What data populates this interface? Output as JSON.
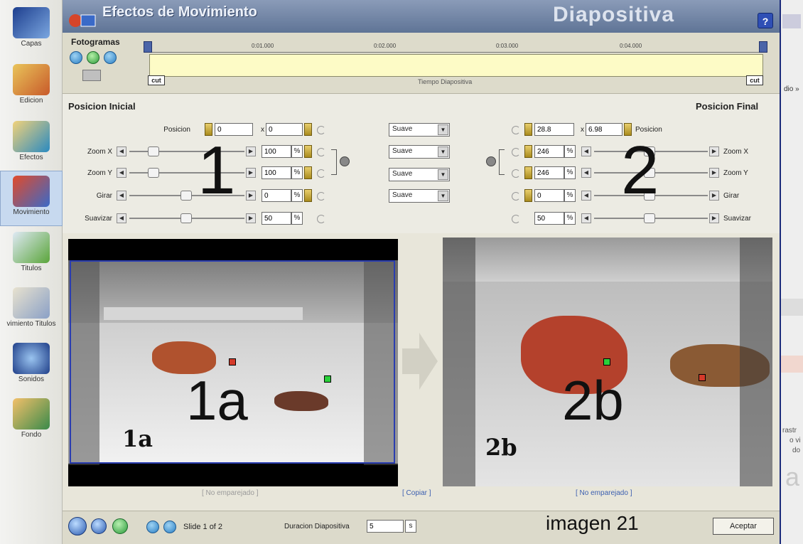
{
  "sidebar": {
    "items": [
      {
        "label": "Capas",
        "color": "#3e6ab8"
      },
      {
        "label": "Edicion",
        "color": "#c85a2a"
      },
      {
        "label": "Efectos",
        "color": "#2a8ac0"
      },
      {
        "label": "Movimiento",
        "color": "#cf3b2a"
      },
      {
        "label": "Titulos",
        "color": "#5aa53a"
      },
      {
        "label": "vimiento Titulos",
        "color": "#8aa0c6"
      },
      {
        "label": "Sonidos",
        "color": "#2f5aa8"
      },
      {
        "label": "Fondo",
        "color": "#d9823a"
      }
    ],
    "active_index": 3
  },
  "dialog": {
    "title": "Efectos de Movimiento",
    "mode": "Diapositiva",
    "help": "?"
  },
  "timeline": {
    "frames_label": "Fotogramas",
    "ticks": [
      "0:01.000",
      "0:02.000",
      "0:03.000",
      "0:04.000"
    ],
    "track_label": "Tiempo Diapositiva",
    "cut_left": "cut",
    "cut_right": "cut"
  },
  "initial": {
    "title": "Posicion Inicial",
    "pos_label": "Posicion",
    "pos_x": "0",
    "pos_sep": "x",
    "pos_y": "0",
    "zoomx_label": "Zoom X",
    "zoomx": "100",
    "zoomy_label": "Zoom Y",
    "zoomy": "100",
    "rotate_label": "Girar",
    "rotate": "0",
    "smooth_label": "Suavizar",
    "smooth": "50",
    "unit": "%"
  },
  "easing": [
    "Suave",
    "Suave",
    "Suave",
    "Suave"
  ],
  "final": {
    "title": "Posicion Final",
    "pos_label": "Posicion",
    "pos_x": "28.8",
    "pos_sep": "x",
    "pos_y": "6.98",
    "zoomx_label": "Zoom X",
    "zoomx": "246",
    "zoomy_label": "Zoom Y",
    "zoomy": "246",
    "rotate_label": "Girar",
    "rotate": "0",
    "smooth_label": "Suavizar",
    "smooth": "50",
    "unit": "%"
  },
  "annotations": {
    "n1": "1",
    "n2": "2",
    "img_a_big": "1a",
    "img_a_small": "1a",
    "img_b_big": "2b",
    "img_b_small": "2b",
    "imagen": "imagen 21"
  },
  "preview": {
    "unpaired_left": "[ No emparejado ]",
    "copy": "[ Copiar ]",
    "unpaired_right": "[ No emparejado ]"
  },
  "bottom": {
    "slide_info": "Slide 1 of 2",
    "duration_label": "Duracion Diapositiva",
    "duration_value": "5",
    "duration_unit": "s",
    "accept": "Aceptar"
  },
  "right_strip": {
    "text1": "dio »",
    "text2": "rastr",
    "text3": "o vi",
    "text4": "do",
    "text5": "a"
  }
}
